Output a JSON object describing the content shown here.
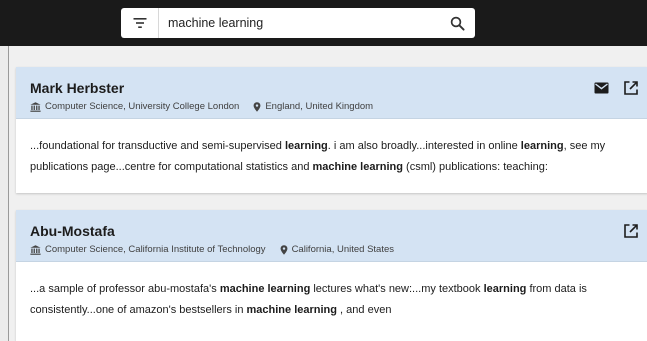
{
  "search": {
    "query": "machine learning",
    "filter_icon": "filter-icon",
    "search_icon": "search-icon"
  },
  "results": [
    {
      "name": "Mark Herbster",
      "department": "Computer Science, University College London",
      "location": "England, United Kingdom",
      "actions": [
        "email-icon",
        "open-external-icon"
      ],
      "snippet": [
        {
          "t": "...foundational for transductive and semi-supervised ",
          "b": false
        },
        {
          "t": "learning",
          "b": true
        },
        {
          "t": ". i am also broadly...interested in online ",
          "b": false
        },
        {
          "t": "learning",
          "b": true
        },
        {
          "t": ", see my publications page...centre for computational statistics and ",
          "b": false
        },
        {
          "t": "machine learning",
          "b": true
        },
        {
          "t": " (csml) publications: teaching:",
          "b": false
        }
      ]
    },
    {
      "name": "Abu-Mostafa",
      "department": "Computer Science, California Institute of Technology",
      "location": "California, United States",
      "actions": [
        "open-external-icon"
      ],
      "snippet": [
        {
          "t": "...a sample of professor abu-mostafa's ",
          "b": false
        },
        {
          "t": "machine learning",
          "b": true
        },
        {
          "t": " lectures what's new:...my textbook ",
          "b": false
        },
        {
          "t": "learning",
          "b": true
        },
        {
          "t": " from data is consistently...one of amazon's bestsellers in ",
          "b": false
        },
        {
          "t": "machine learning",
          "b": true
        },
        {
          "t": " , and even",
          "b": false
        }
      ]
    }
  ],
  "colors": {
    "topbar": "#1a1a1a",
    "card_header": "#d4e3f3",
    "background": "#f0f0f0",
    "text": "#1c1c1c"
  }
}
